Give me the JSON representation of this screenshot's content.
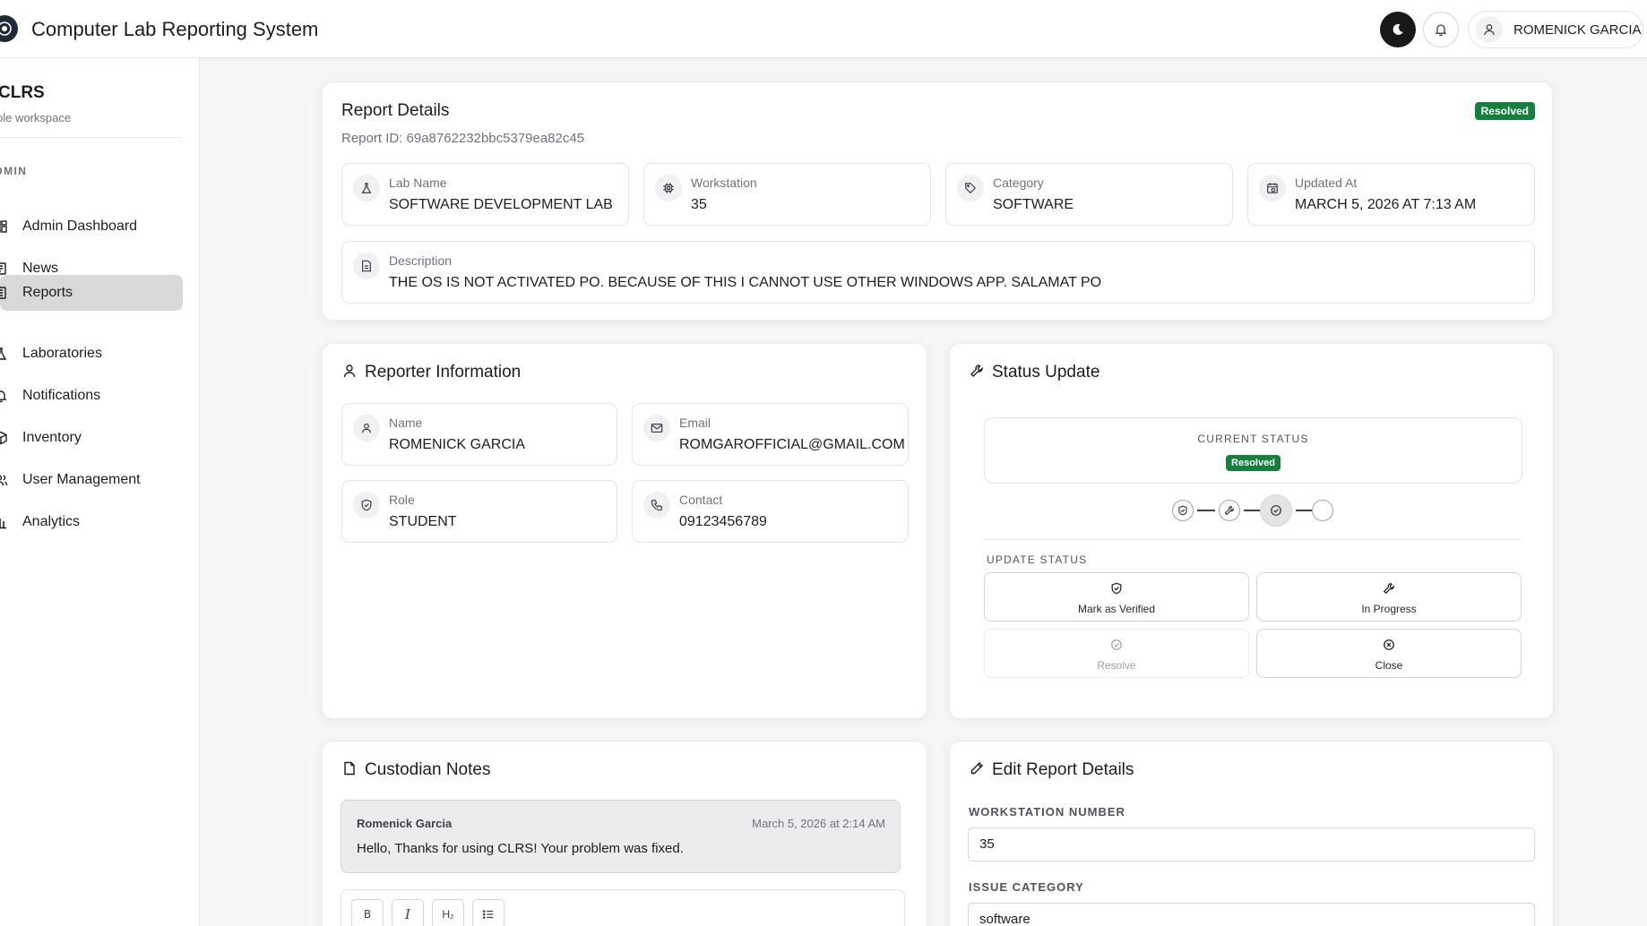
{
  "header": {
    "title": "Computer Lab Reporting System",
    "user_name": "ROMENICK GARCIA"
  },
  "sidebar": {
    "app_name": "CLRS",
    "workspace": "ole workspace",
    "section": "DMIN",
    "items": [
      {
        "label": "Admin Dashboard",
        "icon": "dashboard-icon"
      },
      {
        "label": "News",
        "icon": "newspaper-icon"
      },
      {
        "label": "Reports",
        "icon": "report-icon",
        "active": true
      },
      {
        "label": "Laboratories",
        "icon": "flask-icon"
      },
      {
        "label": "Notifications",
        "icon": "bell-icon"
      },
      {
        "label": "Inventory",
        "icon": "box-icon"
      },
      {
        "label": "User Management",
        "icon": "users-icon"
      },
      {
        "label": "Analytics",
        "icon": "bar-chart-icon"
      }
    ]
  },
  "report": {
    "title": "Report Details",
    "status_badge": "Resolved",
    "report_id": "Report ID: 69a8762232bbc5379ea82c45",
    "fields": [
      {
        "label": "Lab Name",
        "value": "SOFTWARE DEVELOPMENT LAB",
        "icon": "flask-icon"
      },
      {
        "label": "Workstation",
        "value": "35",
        "icon": "cpu-icon"
      },
      {
        "label": "Category",
        "value": "SOFTWARE",
        "icon": "tag-icon"
      },
      {
        "label": "Updated At",
        "value": "MARCH 5, 2026 AT 7:13 AM",
        "icon": "calendar-icon"
      }
    ],
    "description_label": "Description",
    "description": "THE OS IS NOT ACTIVATED PO. BECAUSE OF THIS I CANNOT USE OTHER WINDOWS APP. SALAMAT PO"
  },
  "reporter": {
    "title": "Reporter Information",
    "fields": [
      {
        "label": "Name",
        "value": "ROMENICK GARCIA",
        "icon": "user-icon"
      },
      {
        "label": "Email",
        "value": "ROMGAROFFICIAL@GMAIL.COM",
        "icon": "mail-icon"
      },
      {
        "label": "Role",
        "value": "STUDENT",
        "icon": "shield-icon"
      },
      {
        "label": "Contact",
        "value": "09123456789",
        "icon": "phone-icon"
      }
    ]
  },
  "status_update": {
    "title": "Status Update",
    "current_label": "CURRENT STATUS",
    "current_value": "Resolved",
    "update_label": "UPDATE STATUS",
    "buttons": [
      {
        "label": "Mark as Verified",
        "icon": "shield-check-icon"
      },
      {
        "label": "In Progress",
        "icon": "wrench-icon"
      },
      {
        "label": "Resolve",
        "icon": "check-circle-icon",
        "disabled": true
      },
      {
        "label": "Close",
        "icon": "x-circle-icon"
      }
    ]
  },
  "notes": {
    "title": "Custodian Notes",
    "items": [
      {
        "author": "Romenick Garcia",
        "time": "March 5, 2026 at 2:14 AM",
        "text": "Hello, Thanks for using CLRS! Your problem was fixed."
      }
    ],
    "toolbar": {
      "bold": "B",
      "italic": "I",
      "heading": "H₂",
      "list": "list-icon"
    }
  },
  "edit": {
    "title": "Edit Report Details",
    "workstation_label": "WORKSTATION NUMBER",
    "workstation_value": "35",
    "category_label": "ISSUE CATEGORY",
    "category_value": "software"
  }
}
